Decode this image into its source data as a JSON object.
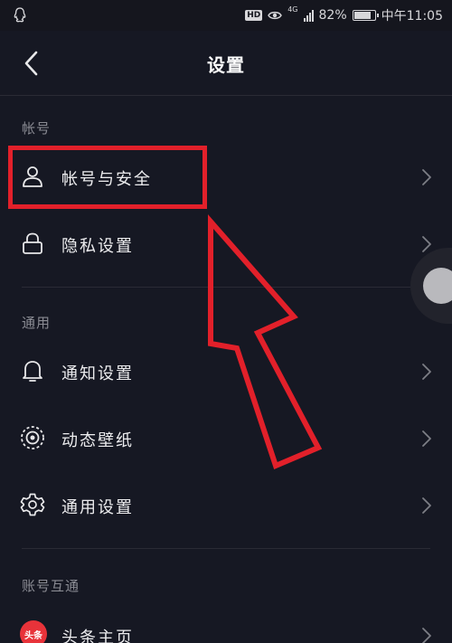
{
  "status_bar": {
    "hd": "HD",
    "network": "4G",
    "battery_percent": "82%",
    "battery_level": 0.82,
    "time": "中午11:05"
  },
  "header": {
    "title": "设置"
  },
  "sections": [
    {
      "title": "帐号",
      "items": [
        {
          "label": "帐号与安全",
          "icon": "user-icon"
        },
        {
          "label": "隐私设置",
          "icon": "lock-icon"
        }
      ]
    },
    {
      "title": "通用",
      "items": [
        {
          "label": "通知设置",
          "icon": "bell-icon"
        },
        {
          "label": "动态壁纸",
          "icon": "live-wallpaper-icon"
        },
        {
          "label": "通用设置",
          "icon": "gear-icon"
        }
      ]
    },
    {
      "title": "账号互通",
      "items": [
        {
          "label": "头条主页",
          "icon": "toutiao-logo",
          "logo_text": "头条"
        }
      ]
    }
  ],
  "colors": {
    "background": "#161823",
    "annotation_red": "#e2202a",
    "divider": "#2a2b35"
  }
}
